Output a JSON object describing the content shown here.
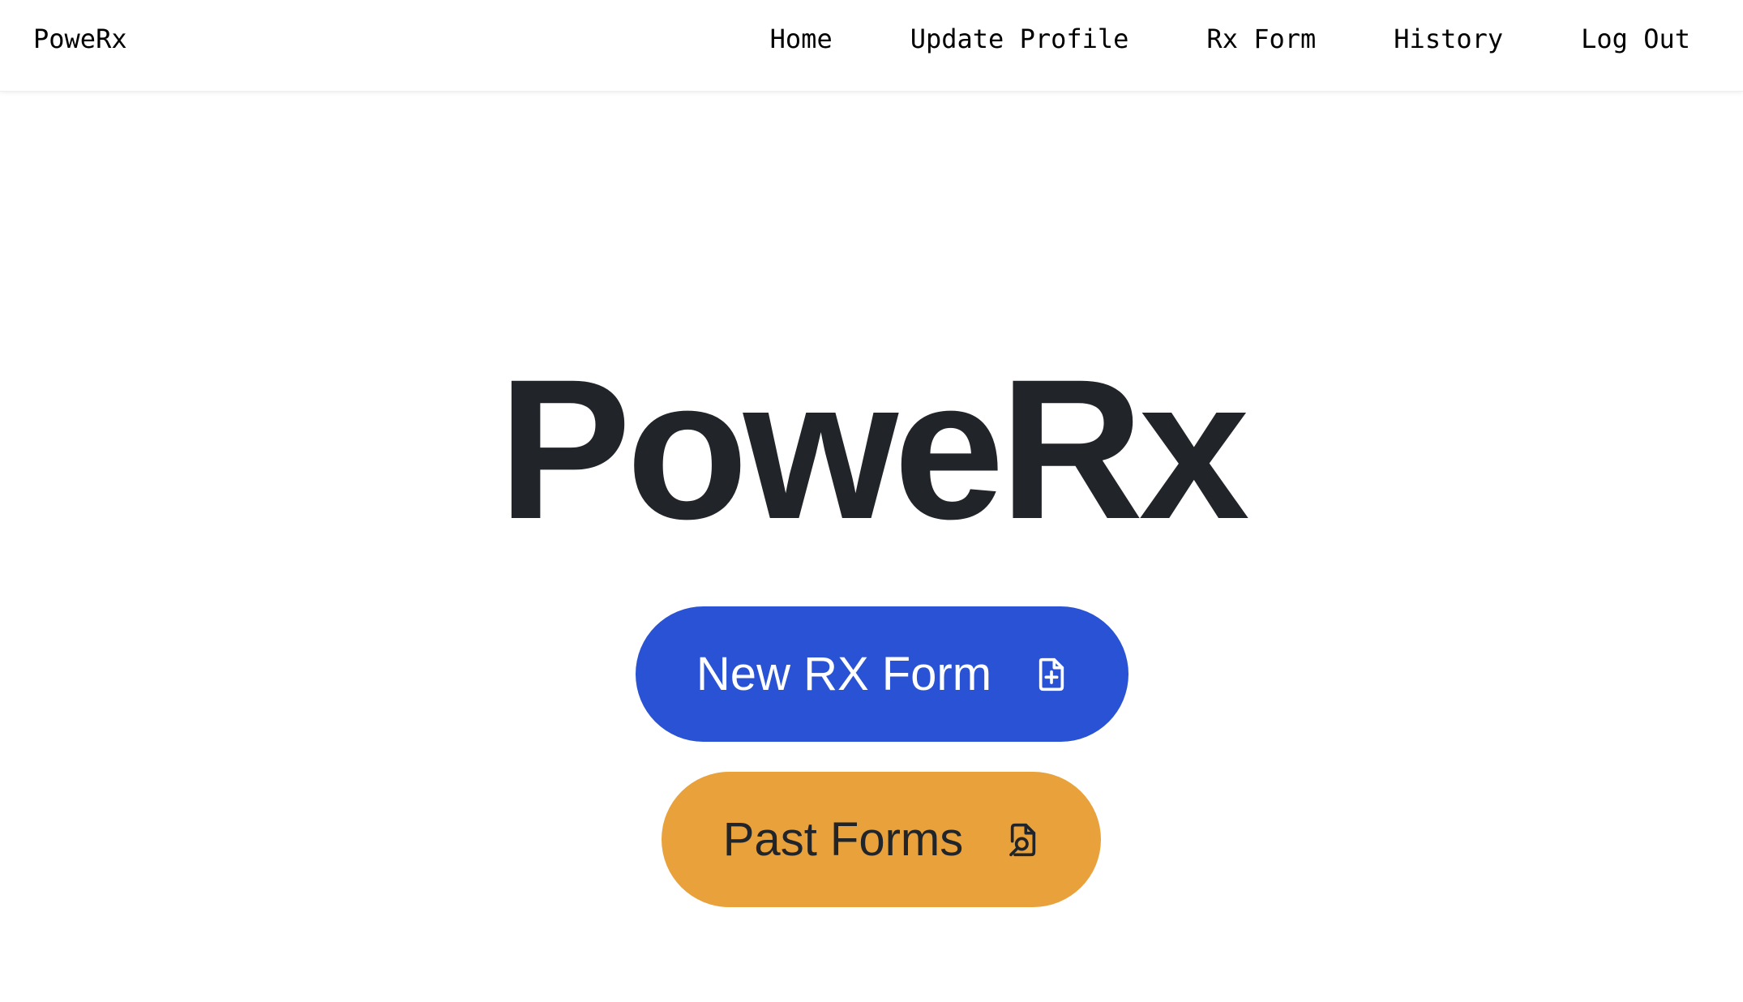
{
  "navbar": {
    "brand": "PoweRx",
    "links": [
      {
        "label": "Home"
      },
      {
        "label": "Update Profile"
      },
      {
        "label": "Rx Form"
      },
      {
        "label": "History"
      },
      {
        "label": "Log Out"
      }
    ]
  },
  "hero": {
    "title": "PoweRx"
  },
  "actions": {
    "new_form": {
      "label": "New RX Form",
      "icon": "file-plus-icon",
      "color": "#2952d4"
    },
    "past_forms": {
      "label": "Past Forms",
      "icon": "file-search-icon",
      "color": "#e8a13b"
    }
  }
}
